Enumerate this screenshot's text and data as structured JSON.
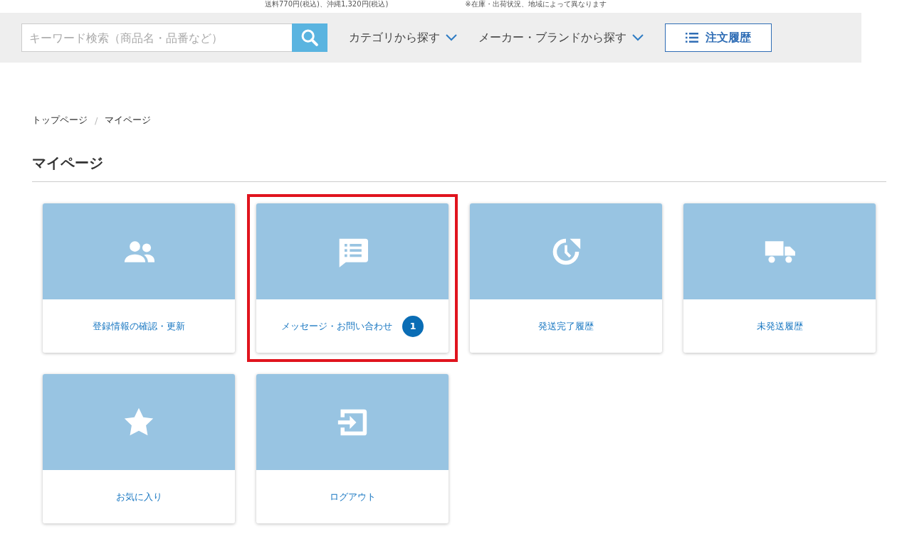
{
  "top_notes": [
    "送料770円(税込)、沖縄1,320円(税込)",
    "※在庫・出荷状況、地域によって異なります"
  ],
  "header": {
    "search": {
      "placeholder": "キーワード検索（商品名・品番など）"
    },
    "nav": [
      {
        "label": "カテゴリから探す"
      },
      {
        "label": "メーカー・ブランドから探す"
      }
    ],
    "order_history_button": "注文履歴"
  },
  "breadcrumb": [
    {
      "kind": "link",
      "text": "トップページ"
    },
    {
      "kind": "separator",
      "text": "/"
    },
    {
      "kind": "current",
      "text": "マイページ"
    }
  ],
  "page_title": "マイページ",
  "cards": [
    {
      "label": "登録情報の確認・更新",
      "highlighted": false
    },
    {
      "label": "メッセージ・お問い合わせ",
      "badge": "1",
      "highlighted": true
    },
    {
      "label": "発送完了履歴",
      "highlighted": false
    },
    {
      "label": "未発送履歴",
      "highlighted": false
    },
    {
      "label": "お気に入り",
      "highlighted": false
    },
    {
      "label": "ログアウト",
      "highlighted": false
    }
  ]
}
